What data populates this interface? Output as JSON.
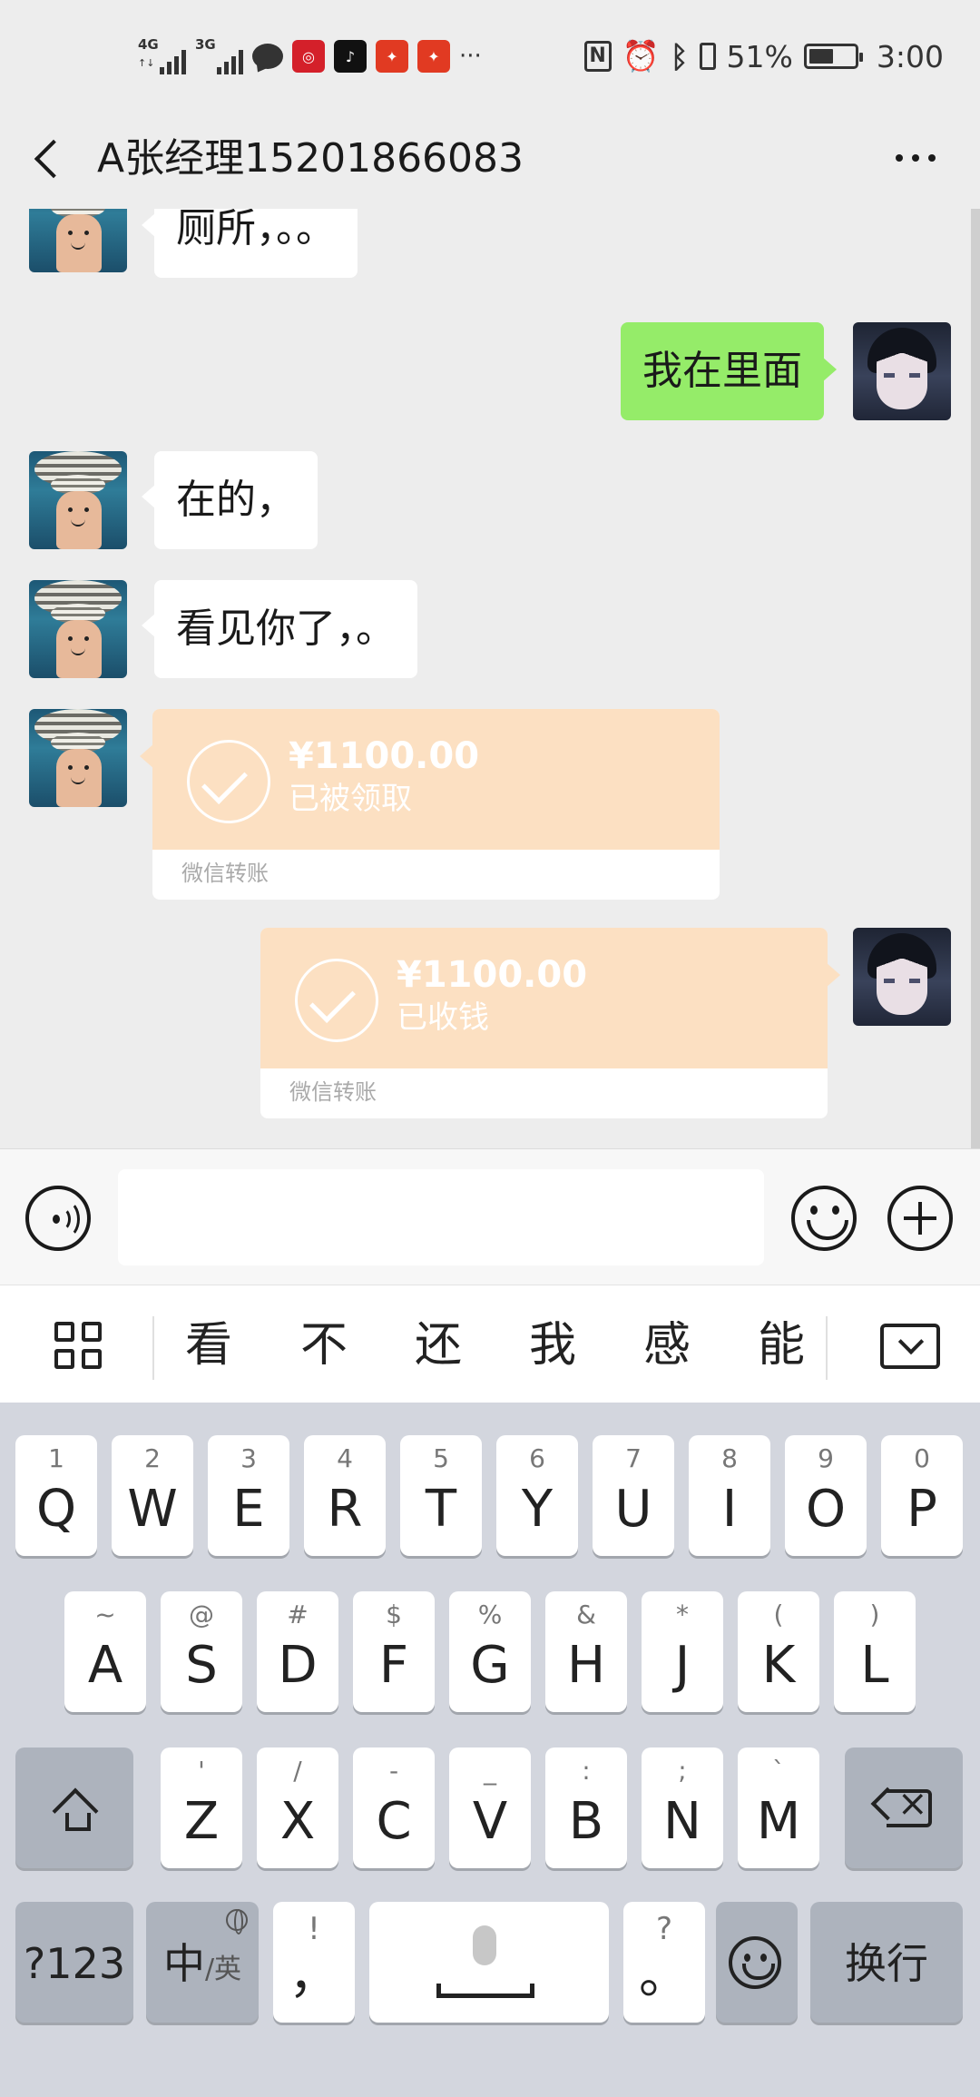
{
  "status_bar": {
    "net1": "4G",
    "net2": "3G",
    "battery_percent": "51%",
    "time": "3:00",
    "more_dots": "···",
    "app_icons": [
      "bank-app-icon",
      "tiktok-icon",
      "red-app-icon",
      "red-app-icon-2"
    ]
  },
  "header": {
    "title": "A张经理15201866083"
  },
  "messages": [
    {
      "side": "left",
      "text": "厕所，。。"
    },
    {
      "side": "right",
      "text": "我在里面"
    },
    {
      "side": "left",
      "text": "在的，"
    },
    {
      "side": "left",
      "text": "看见你了，。"
    }
  ],
  "transfers": [
    {
      "side": "left",
      "amount": "¥1100.00",
      "status": "已被领取",
      "footer": "微信转账"
    },
    {
      "side": "right",
      "amount": "¥1100.00",
      "status": "已收钱",
      "footer": "微信转账"
    }
  ],
  "candidates": [
    "看",
    "不",
    "还",
    "我",
    "感",
    "能"
  ],
  "keyboard": {
    "row1": [
      {
        "sub": "1",
        "main": "Q"
      },
      {
        "sub": "2",
        "main": "W"
      },
      {
        "sub": "3",
        "main": "E"
      },
      {
        "sub": "4",
        "main": "R"
      },
      {
        "sub": "5",
        "main": "T"
      },
      {
        "sub": "6",
        "main": "Y"
      },
      {
        "sub": "7",
        "main": "U"
      },
      {
        "sub": "8",
        "main": "I"
      },
      {
        "sub": "9",
        "main": "O"
      },
      {
        "sub": "0",
        "main": "P"
      }
    ],
    "row2": [
      {
        "sub": "~",
        "main": "A"
      },
      {
        "sub": "@",
        "main": "S"
      },
      {
        "sub": "#",
        "main": "D"
      },
      {
        "sub": "$",
        "main": "F"
      },
      {
        "sub": "%",
        "main": "G"
      },
      {
        "sub": "&",
        "main": "H"
      },
      {
        "sub": "*",
        "main": "J"
      },
      {
        "sub": "(",
        "main": "K"
      },
      {
        "sub": ")",
        "main": "L"
      }
    ],
    "row3": [
      {
        "sub": "'",
        "main": "Z"
      },
      {
        "sub": "/",
        "main": "X"
      },
      {
        "sub": "-",
        "main": "C"
      },
      {
        "sub": "_",
        "main": "V"
      },
      {
        "sub": ":",
        "main": "B"
      },
      {
        "sub": ";",
        "main": "N"
      },
      {
        "sub": "`",
        "main": "M"
      }
    ],
    "num_key": "?123",
    "lang_main": "中",
    "lang_sub": "/英",
    "comma_sub": "!",
    "comma_main": "，",
    "period_sub": "?",
    "period_main": "。",
    "enter_key": "换行"
  }
}
